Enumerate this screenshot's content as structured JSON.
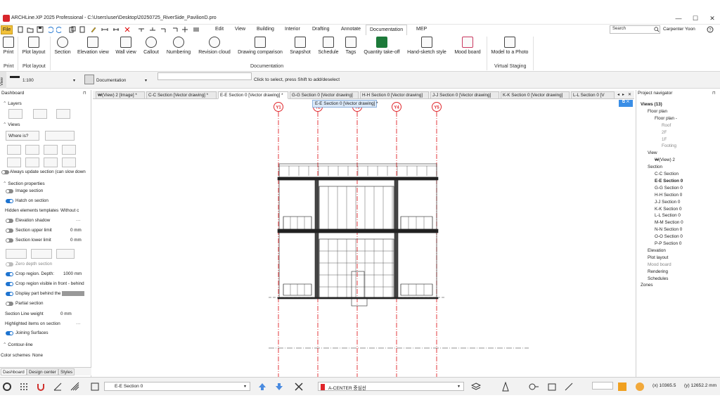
{
  "window": {
    "title": "ARCHLine.XP 2025 Professional - C:\\Users\\user\\Desktop\\20250725_RiverSide_PavilionD.pro",
    "minimize": "—",
    "maximize": "☐",
    "close": "✕"
  },
  "menubar": {
    "file": "File",
    "items": [
      "Edit",
      "View",
      "Building",
      "Interior",
      "Drafting",
      "Annotate",
      "Documentation",
      "MEP"
    ],
    "active": "Documentation",
    "search_placeholder": "Search",
    "user": "Carpenter Yoon"
  },
  "ribbon": {
    "buttons": [
      {
        "label": "Print",
        "icon": "printer-icon"
      },
      {
        "label": "Plot layout",
        "icon": "plot-layout-icon"
      },
      {
        "label": "Section",
        "icon": "section-icon"
      },
      {
        "label": "Elevation view",
        "icon": "elevation-icon"
      },
      {
        "label": "Wall view",
        "icon": "wall-view-icon"
      },
      {
        "label": "Callout",
        "icon": "callout-icon"
      },
      {
        "label": "Numbering",
        "icon": "numbering-icon"
      },
      {
        "label": "Revision cloud",
        "icon": "revision-cloud-icon"
      },
      {
        "label": "Drawing comparison",
        "icon": "drawing-comparison-icon"
      },
      {
        "label": "Snapshot",
        "icon": "camera-icon"
      },
      {
        "label": "Schedule",
        "icon": "schedule-icon"
      },
      {
        "label": "Tags",
        "icon": "tags-icon"
      },
      {
        "label": "Quantity take-off",
        "icon": "excel-icon"
      },
      {
        "label": "Hand-sketch style",
        "icon": "hand-sketch-icon"
      },
      {
        "label": "Mood board",
        "icon": "mood-board-icon"
      },
      {
        "label": "Model to a Photo",
        "icon": "model-to-photo-icon"
      }
    ],
    "groups": {
      "print": "Print",
      "plot": "Plot layout",
      "documentation": "Documentation",
      "staging": "Virtual Staging"
    }
  },
  "toolbar": {
    "view_label": "View",
    "scale": "1:100",
    "workspace": "Documentation",
    "hint": "Click to select, press Shift to add/deselect"
  },
  "dashboard": {
    "title": "Dashboard",
    "layers": "Layers",
    "views": "Views",
    "where_is": "Where is?",
    "always_update": "Always update section (can slow down",
    "section_properties": "Section properties",
    "image_section": "Image section",
    "hatch_on_section": "Hatch on section",
    "hidden_templates": "Hidden elements templates",
    "hidden_templates_value": "Without c",
    "elevation_shadow": "Elevation shadow",
    "upper_limit": "Section upper limit",
    "upper_limit_value": "0 mm",
    "lower_limit": "Section lower limit",
    "lower_limit_value": "0 mm",
    "zero_depth": "Zero depth section",
    "crop_depth": "Crop region. Depth:",
    "crop_depth_value": "1000 mm",
    "crop_visible": "Crop region visible in front - behind",
    "display_behind": "Display part behind the",
    "partial_section": "Partial section",
    "line_weight": "Section Line weight",
    "line_weight_value": "0 mm",
    "highlighted": "Highlighted items on section",
    "joining": "Joining Surfaces",
    "contour": "Contour-line",
    "color_schemes": "Color schemes",
    "color_schemes_value": "None",
    "tabs": [
      "Dashboard",
      "Design center",
      "Styles"
    ]
  },
  "doc_tabs": [
    "₩(View) 2 [Image] *",
    "C-C Section [Vector drawing] *",
    "E-E Section 0 [Vector drawing] *",
    "G-G Section 0 [Vector drawing]",
    "H-H Section 0 [Vector drawing]",
    "J-J Section 0 [Vector drawing]",
    "K-K Section 0 [Vector drawing]",
    "L-L Section 0 [V"
  ],
  "tooltip": "E-E Section 0 [Vector drawing] *",
  "grid_labels": [
    "Y1",
    "Y2",
    "Y3",
    "Y4",
    "Y5"
  ],
  "navigator": {
    "title": "Project navigator",
    "items": [
      {
        "text": "Views (13)",
        "indent": 0,
        "style": "bold"
      },
      {
        "text": "Floor plan",
        "indent": 1,
        "style": ""
      },
      {
        "text": "Floor plan -",
        "indent": 2,
        "style": ""
      },
      {
        "text": "Roof",
        "indent": 3,
        "style": "gray"
      },
      {
        "text": "2F",
        "indent": 3,
        "style": "gray"
      },
      {
        "text": "1F",
        "indent": 3,
        "style": "gray"
      },
      {
        "text": "Footing",
        "indent": 3,
        "style": "gray"
      },
      {
        "text": "View",
        "indent": 1,
        "style": ""
      },
      {
        "text": "₩(View) 2",
        "indent": 2,
        "style": ""
      },
      {
        "text": "Section",
        "indent": 1,
        "style": ""
      },
      {
        "text": "C-C Section",
        "indent": 2,
        "style": ""
      },
      {
        "text": "E-E Section 0",
        "indent": 2,
        "style": "bold"
      },
      {
        "text": "G-G Section 0",
        "indent": 2,
        "style": ""
      },
      {
        "text": "H-H Section 0",
        "indent": 2,
        "style": ""
      },
      {
        "text": "J-J Section 0",
        "indent": 2,
        "style": ""
      },
      {
        "text": "K-K Section 0",
        "indent": 2,
        "style": ""
      },
      {
        "text": "L-L Section 0",
        "indent": 2,
        "style": ""
      },
      {
        "text": "M-M Section 0",
        "indent": 2,
        "style": ""
      },
      {
        "text": "N-N Section 0",
        "indent": 2,
        "style": ""
      },
      {
        "text": "O-O Section 0",
        "indent": 2,
        "style": ""
      },
      {
        "text": "P-P Section 0",
        "indent": 2,
        "style": ""
      },
      {
        "text": "Elevation",
        "indent": 1,
        "style": ""
      },
      {
        "text": "Plot layout",
        "indent": 1,
        "style": ""
      },
      {
        "text": "Mood board",
        "indent": 1,
        "style": "gray"
      },
      {
        "text": "Rendering",
        "indent": 1,
        "style": ""
      },
      {
        "text": "Schedules",
        "indent": 1,
        "style": ""
      },
      {
        "text": "Zones",
        "indent": 0,
        "style": ""
      }
    ]
  },
  "status": {
    "current_view": "E-E Section 0",
    "layer": "A-CENTER 중심선",
    "x": "(x) 10365.5",
    "y": "(y) 12652.2 mm"
  },
  "colors": {
    "accent": "#1e74d0",
    "grid_red": "#e0262b",
    "file_btn": "#f2c13a"
  }
}
